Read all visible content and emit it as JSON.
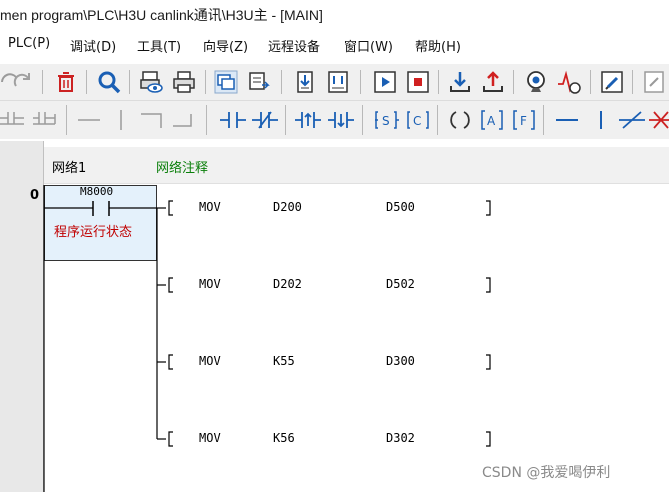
{
  "window": {
    "title": "men program\\PLC\\H3U canlink通讯\\H3U主 - [MAIN]"
  },
  "menu": [
    {
      "label": "PLC(P)"
    },
    {
      "label": "调试(D)"
    },
    {
      "label": "工具(T)"
    },
    {
      "label": "向导(Z)"
    },
    {
      "label": "远程设备"
    },
    {
      "label": "窗口(W)"
    },
    {
      "label": "帮助(H)"
    }
  ],
  "toolbar1_icons": [
    "redo-icon",
    "delete-icon",
    "search-icon",
    "monitor-icon",
    "print-icon",
    "cascade-windows-icon",
    "tile-windows-icon",
    "download-doc-icon",
    "compare-doc-icon",
    "run-icon",
    "stop-icon",
    "download-icon",
    "upload-icon",
    "webcam-icon",
    "trace-icon",
    "edit-icon",
    "notes-icon"
  ],
  "toolbar2_icons": [
    "parallel-branch-icon",
    "parallel-branch-alt-icon",
    "horizontal-line-icon",
    "vertical-line-icon",
    "branch-down-icon",
    "branch-up-icon",
    "no-contact-icon",
    "nc-contact-icon",
    "rising-edge-icon",
    "falling-edge-icon",
    "set-instruction-icon",
    "compare-instruction-icon",
    "coil-icon",
    "application-icon",
    "function-icon",
    "horizontal-wire-icon",
    "vertical-wire-icon",
    "invert-icon",
    "delete-wire-icon"
  ],
  "editor": {
    "step": "0",
    "network_label": "网络1",
    "network_comment": "网络注释",
    "contact": {
      "address": "M8000",
      "comment": "程序运行状态"
    },
    "instructions": [
      {
        "op": "MOV",
        "src": "D200",
        "dst": "D500"
      },
      {
        "op": "MOV",
        "src": "D202",
        "dst": "D502"
      },
      {
        "op": "MOV",
        "src": "K55",
        "dst": "D300"
      },
      {
        "op": "MOV",
        "src": "K56",
        "dst": "D302"
      }
    ]
  },
  "watermark": "CSDN @我爱喝伊利",
  "colors": {
    "comment_green": "#0a7f0a",
    "contact_comment_red": "#c00000",
    "contact_box_fill": "#e4f1fb"
  }
}
